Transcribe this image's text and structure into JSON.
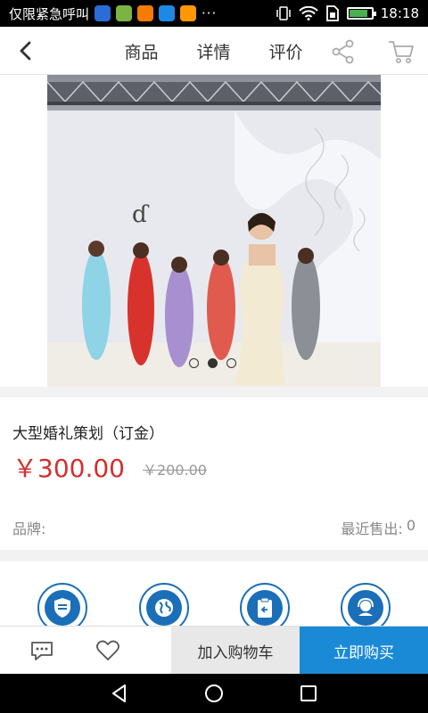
{
  "statusbar": {
    "carrier_text": "仅限紧急呼叫",
    "more": "···",
    "time": "18:18",
    "battery_level": 0.85,
    "app_icon_colors": [
      "#2b6cd6",
      "#7cb342",
      "#f57c00",
      "#1e88e5",
      "#ff9800"
    ]
  },
  "nav": {
    "tabs": [
      "商品",
      "详情",
      "评价"
    ],
    "active_tab": 0,
    "accent": "#1a8ad6"
  },
  "gallery": {
    "slide_count": 3,
    "active_slide": 1
  },
  "product": {
    "title": "大型婚礼策划（订金）",
    "price": "￥300.00",
    "old_price": "￥200.00",
    "brand_label": "品牌:",
    "sold_label": "最近售出:",
    "sold_count": "0",
    "price_color": "#d32f2f"
  },
  "services": {
    "icons": [
      "shield-icon",
      "globe-icon",
      "clipboard-return-icon",
      "customer-service-icon"
    ],
    "color": "#1a6fb8"
  },
  "actions": {
    "add_to_cart": "加入购物车",
    "buy_now": "立即购买"
  }
}
